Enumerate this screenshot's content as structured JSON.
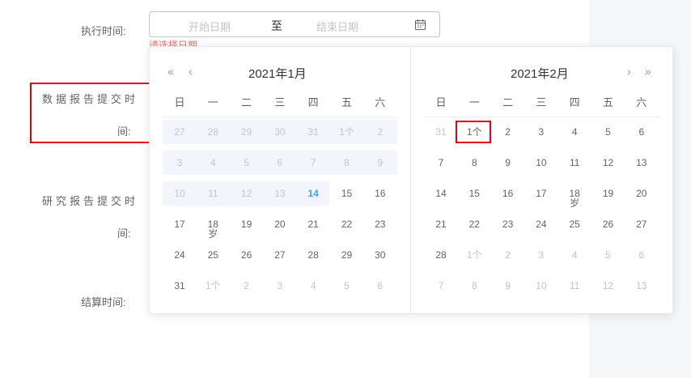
{
  "form": {
    "exec_time_label": "执行时间:",
    "data_report_label_line1": "数据报告提交时",
    "data_report_label_line2": "间:",
    "research_report_label_line1": "研究报告提交时",
    "research_report_label_line2": "间:",
    "settle_time_label": "结算时间:"
  },
  "date_range": {
    "start_placeholder": "开始日期",
    "separator": "至",
    "end_placeholder": "结束日期",
    "error": "请选择日期"
  },
  "picker": {
    "left_title": "2021年1月",
    "right_title": "2021年2月",
    "weekdays": [
      "日",
      "一",
      "二",
      "三",
      "四",
      "五",
      "六"
    ],
    "left_cells": [
      [
        "27",
        "28",
        "29",
        "30",
        "31",
        "1个",
        "2"
      ],
      [
        "3",
        "4",
        "5",
        "6",
        "7",
        "8",
        "9"
      ],
      [
        "10",
        "11",
        "12",
        "13",
        "14",
        "15",
        "16"
      ],
      [
        "17",
        "18",
        "19",
        "20",
        "21",
        "22",
        "23"
      ],
      [
        "24",
        "25",
        "26",
        "27",
        "28",
        "29",
        "30"
      ],
      [
        "31",
        "1个",
        "2",
        "3",
        "4",
        "5",
        "6"
      ]
    ],
    "right_cells": [
      [
        "31",
        "1个",
        "2",
        "3",
        "4",
        "5",
        "6"
      ],
      [
        "7",
        "8",
        "9",
        "10",
        "11",
        "12",
        "13"
      ],
      [
        "14",
        "15",
        "16",
        "17",
        "18",
        "19",
        "20"
      ],
      [
        "21",
        "22",
        "23",
        "24",
        "25",
        "26",
        "27"
      ],
      [
        "28",
        "1个",
        "2",
        "3",
        "4",
        "5",
        "6"
      ],
      [
        "7",
        "8",
        "9",
        "10",
        "11",
        "12",
        "13"
      ]
    ],
    "left_annotation": "岁",
    "right_annotation": "岁",
    "today": "14"
  },
  "colors": {
    "today": "#409eff",
    "highlight": "#e60012",
    "range_bg": "#f2f6fc"
  }
}
